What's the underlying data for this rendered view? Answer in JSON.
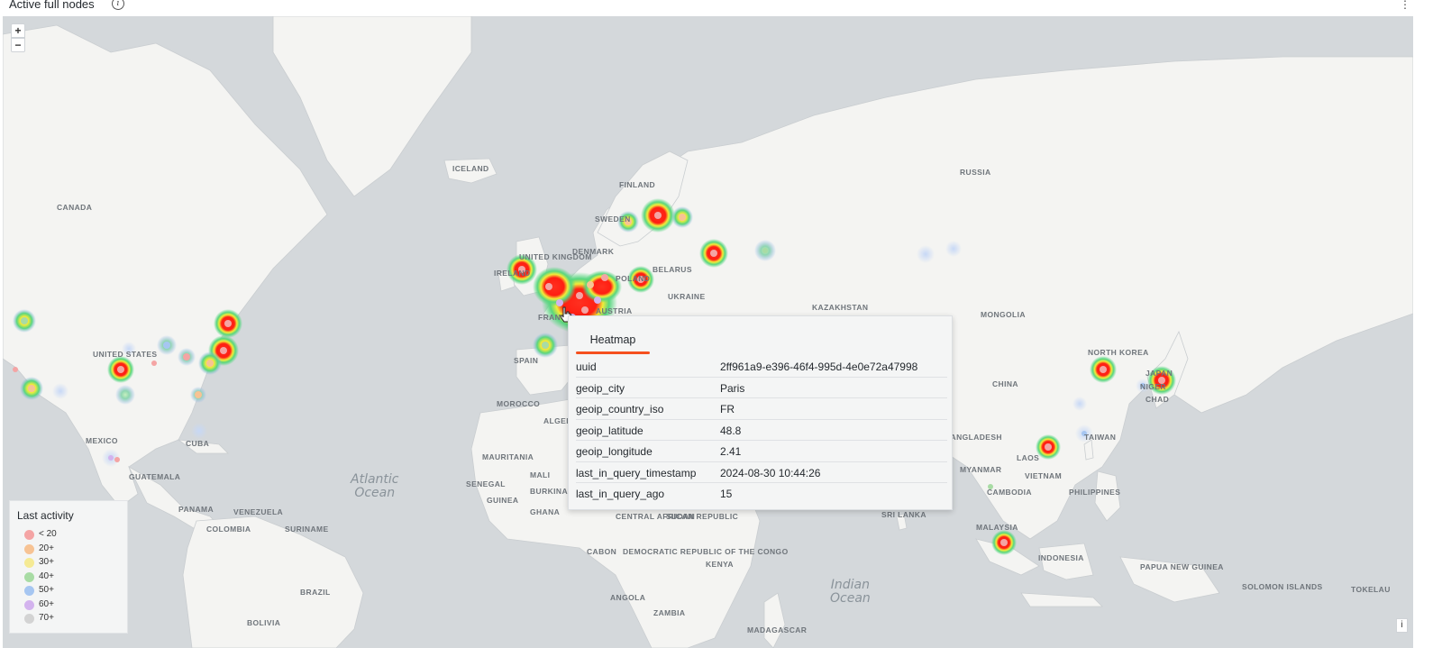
{
  "panel": {
    "title": "Active full nodes",
    "info_icon": "info-icon",
    "menu_icon": "kebab-menu-icon"
  },
  "map": {
    "zoom_in": "+",
    "zoom_out": "−",
    "attribution_button": "i",
    "colors": {
      "water": "#d4d8db",
      "land": "#f4f4f2",
      "border": "#c9cdd0",
      "heat_hot": "#ff1e12",
      "heat_warm": "#f2ec3a",
      "heat_mid": "#58d67f",
      "heat_cool": "#8fb1f0"
    },
    "place_labels": [
      "ICELAND",
      "FINLAND",
      "RUSSIA",
      "CANADA",
      "SWEDEN",
      "DENMARK",
      "UNITED KINGDOM",
      "IRELAND",
      "BELARUS",
      "POLAND",
      "UKRAINE",
      "KAZAKHSTAN",
      "MONGOLIA",
      "FRANCE",
      "AUSTRIA",
      "SPAIN",
      "NORTH KOREA",
      "JAPAN",
      "CHINA",
      "UNITED STATES",
      "MOROCCO",
      "ALGERIA",
      "MAURITANIA",
      "MALI",
      "SENEGAL",
      "GUINEA",
      "BURKINA FASO",
      "GHANA",
      "NIGER",
      "CHAD",
      "SUDAN",
      "CENTRAL AFRICAN REPUBLIC",
      "CABON",
      "DEMOCRATIC REPUBLIC OF THE CONGO",
      "KENYA",
      "ANGOLA",
      "ZAMBIA",
      "MADAGASCAR",
      "MEXICO",
      "CUBA",
      "GUATEMALA",
      "PANAMA",
      "VENEZUELA",
      "COLOMBIA",
      "SURINAME",
      "BRAZIL",
      "BOLIVIA",
      "BANGLADESH",
      "MYANMAR",
      "LAOS",
      "VIETNAM",
      "CAMBODIA",
      "PHILIPPINES",
      "TAIWAN",
      "MALAYSIA",
      "INDONESIA",
      "SRI LANKA",
      "PAPUA NEW GUINEA",
      "SOLOMON ISLANDS",
      "TOKELAU"
    ],
    "ocean_labels": [
      {
        "name": "atlantic",
        "line1": "Atlantic",
        "line2": "Ocean"
      },
      {
        "name": "indian",
        "line1": "Indian",
        "line2": "Ocean"
      }
    ]
  },
  "legend": {
    "title": "Last activity",
    "items": [
      {
        "label": "< 20",
        "color": "#f4a4a4"
      },
      {
        "label": "20+",
        "color": "#f7c394"
      },
      {
        "label": "30+",
        "color": "#f5ea94"
      },
      {
        "label": "40+",
        "color": "#a8dca4"
      },
      {
        "label": "50+",
        "color": "#a6c6f1"
      },
      {
        "label": "60+",
        "color": "#d3b3ee"
      },
      {
        "label": "70+",
        "color": "#d3d3d3"
      }
    ]
  },
  "tooltip": {
    "tab": "Heatmap",
    "rows": [
      {
        "key": "uuid",
        "value": "2ff961a9-e396-46f4-995d-4e0e72a47998"
      },
      {
        "key": "geoip_city",
        "value": "Paris"
      },
      {
        "key": "geoip_country_iso",
        "value": "FR"
      },
      {
        "key": "geoip_latitude",
        "value": "48.8"
      },
      {
        "key": "geoip_longitude",
        "value": "2.41"
      },
      {
        "key": "last_in_query_timestamp",
        "value": "2024-08-30 10:44:26"
      },
      {
        "key": "last_in_query_ago",
        "value": "15"
      }
    ]
  }
}
